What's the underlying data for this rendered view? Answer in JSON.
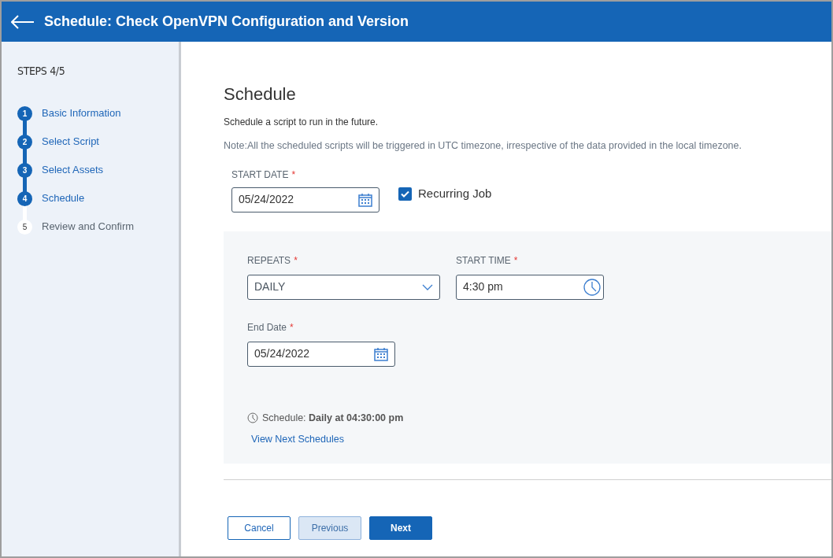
{
  "header": {
    "title": "Schedule: Check OpenVPN Configuration and Version"
  },
  "sidebar": {
    "title": "STEPS 4/5",
    "steps": [
      {
        "number": "1",
        "label": "Basic Information",
        "completed": true
      },
      {
        "number": "2",
        "label": "Select Script",
        "completed": true
      },
      {
        "number": "3",
        "label": "Select Assets",
        "completed": true
      },
      {
        "number": "4",
        "label": "Schedule",
        "completed": true
      },
      {
        "number": "5",
        "label": "Review and Confirm",
        "completed": false
      }
    ]
  },
  "content": {
    "heading": "Schedule",
    "description": "Schedule a script to run in the future.",
    "note": "Note:All the scheduled scripts will be triggered in UTC timezone, irrespective of the data provided in the local timezone.",
    "start_date": {
      "label": "START DATE",
      "required_mark": "*",
      "value": "05/24/2022"
    },
    "recurring": {
      "label": "Recurring Job",
      "checked": true
    },
    "repeats": {
      "label": "REPEATS",
      "required_mark": "*",
      "value": "DAILY"
    },
    "start_time": {
      "label": "START TIME",
      "required_mark": "*",
      "value": "4:30 pm"
    },
    "end_date": {
      "label": "End Date",
      "required_mark": "*",
      "value": "05/24/2022"
    },
    "summary": "Schedule: **Daily at 04:30:00 pm**",
    "view_link": "View Next Schedules"
  },
  "buttons": [
    {
      "label": "Cancel",
      "kind": "outline"
    },
    {
      "label": "Previous",
      "kind": "secondary"
    },
    {
      "label": "Next",
      "kind": "primary"
    }
  ]
}
